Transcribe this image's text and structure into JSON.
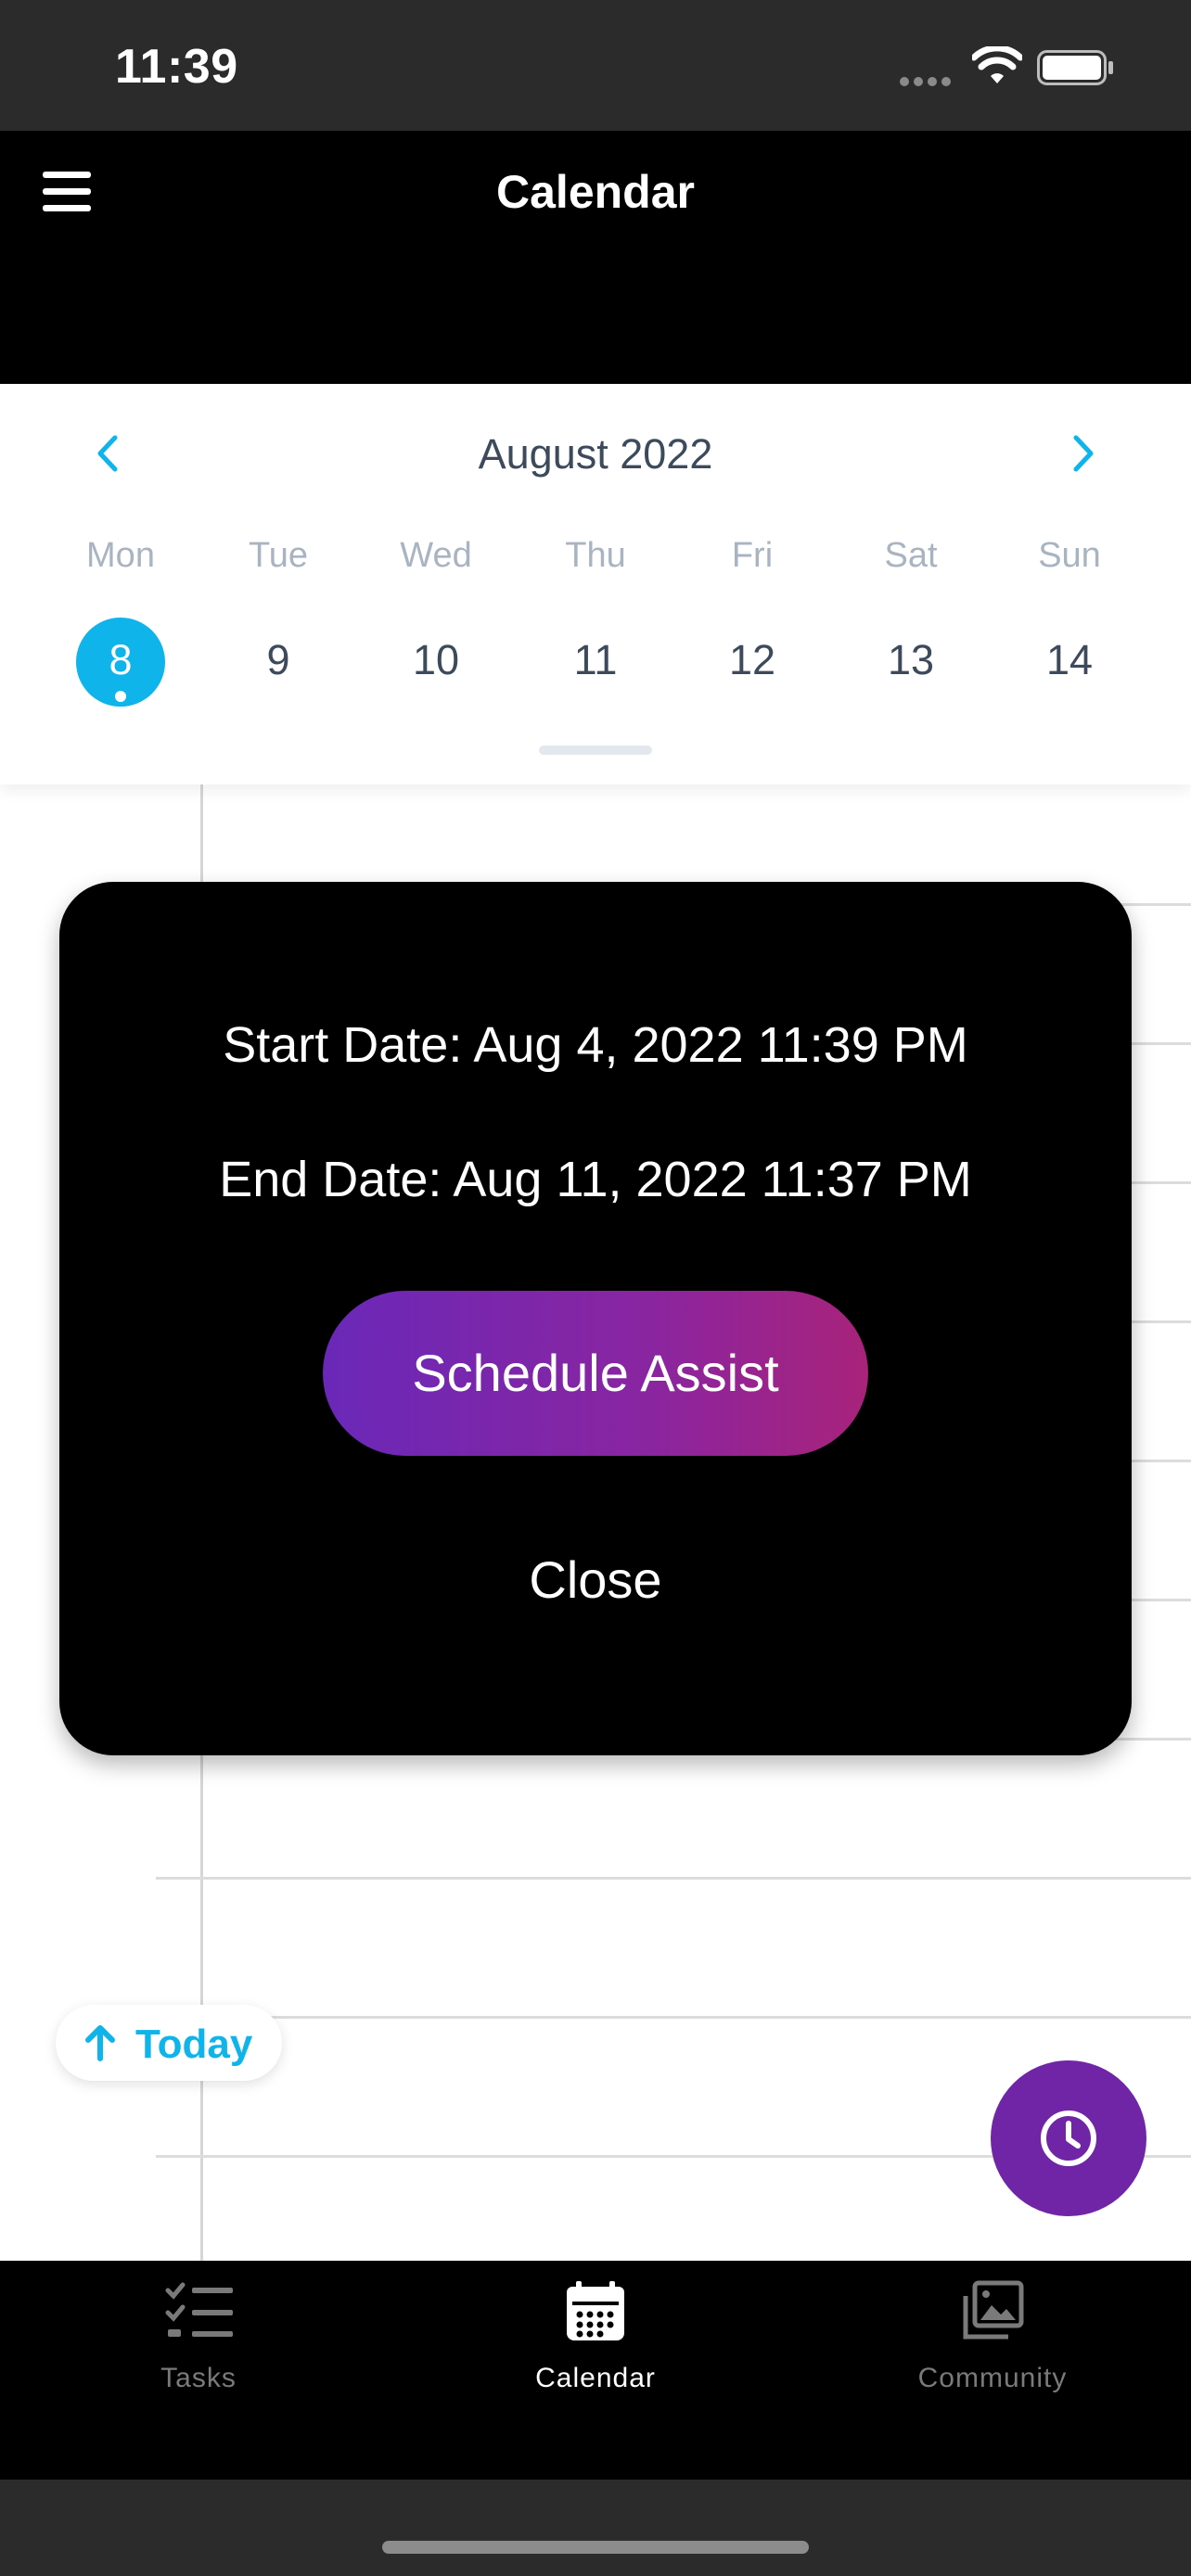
{
  "status_bar": {
    "time": "11:39"
  },
  "header": {
    "title": "Calendar"
  },
  "calendar": {
    "month_label": "August 2022",
    "weekdays": [
      "Mon",
      "Tue",
      "Wed",
      "Thu",
      "Fri",
      "Sat",
      "Sun"
    ],
    "days": [
      "8",
      "9",
      "10",
      "11",
      "12",
      "13",
      "14"
    ],
    "selected_day": "8"
  },
  "modal": {
    "start_date": "Start Date: Aug 4, 2022 11:39 PM",
    "end_date": "End Date: Aug 11, 2022 11:37 PM",
    "schedule_assist_label": "Schedule Assist",
    "close_label": "Close"
  },
  "today_button": {
    "label": "Today"
  },
  "tabs": [
    {
      "label": "Tasks",
      "icon": "tasks-icon",
      "active": false
    },
    {
      "label": "Calendar",
      "icon": "calendar-icon",
      "active": true
    },
    {
      "label": "Community",
      "icon": "gallery-icon",
      "active": false
    }
  ],
  "colors": {
    "accent": "#0eb4ea",
    "fab": "#7025a6",
    "gradient_start": "#6a28b8",
    "gradient_end": "#a8237a",
    "tab_inactive": "#7a7a7a",
    "tab_active": "#ffffff"
  }
}
